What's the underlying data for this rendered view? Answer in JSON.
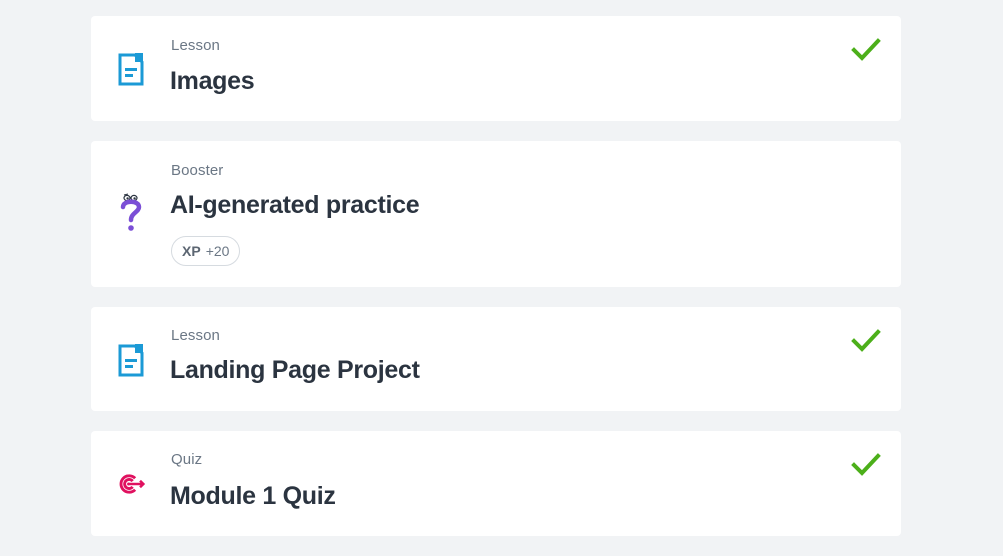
{
  "items": [
    {
      "kind": "Lesson",
      "title": "Images",
      "icon": "lesson-document-icon",
      "completed": true
    },
    {
      "kind": "Booster",
      "title": "AI-generated practice",
      "icon": "booster-question-icon",
      "completed": false,
      "xp": {
        "label": "XP",
        "value": "+20"
      }
    },
    {
      "kind": "Lesson",
      "title": "Landing Page Project",
      "icon": "lesson-document-icon",
      "completed": true
    },
    {
      "kind": "Quiz",
      "title": "Module 1 Quiz",
      "icon": "quiz-target-icon",
      "completed": true
    }
  ],
  "colors": {
    "background": "#f1f3f5",
    "card": "#ffffff",
    "lesson_icon": "#1b9ad6",
    "booster_icon": "#7b4fd6",
    "quiz_icon": "#e0115f",
    "check": "#4caf1a",
    "title_text": "#2b3440",
    "kind_text": "#6b7785"
  }
}
